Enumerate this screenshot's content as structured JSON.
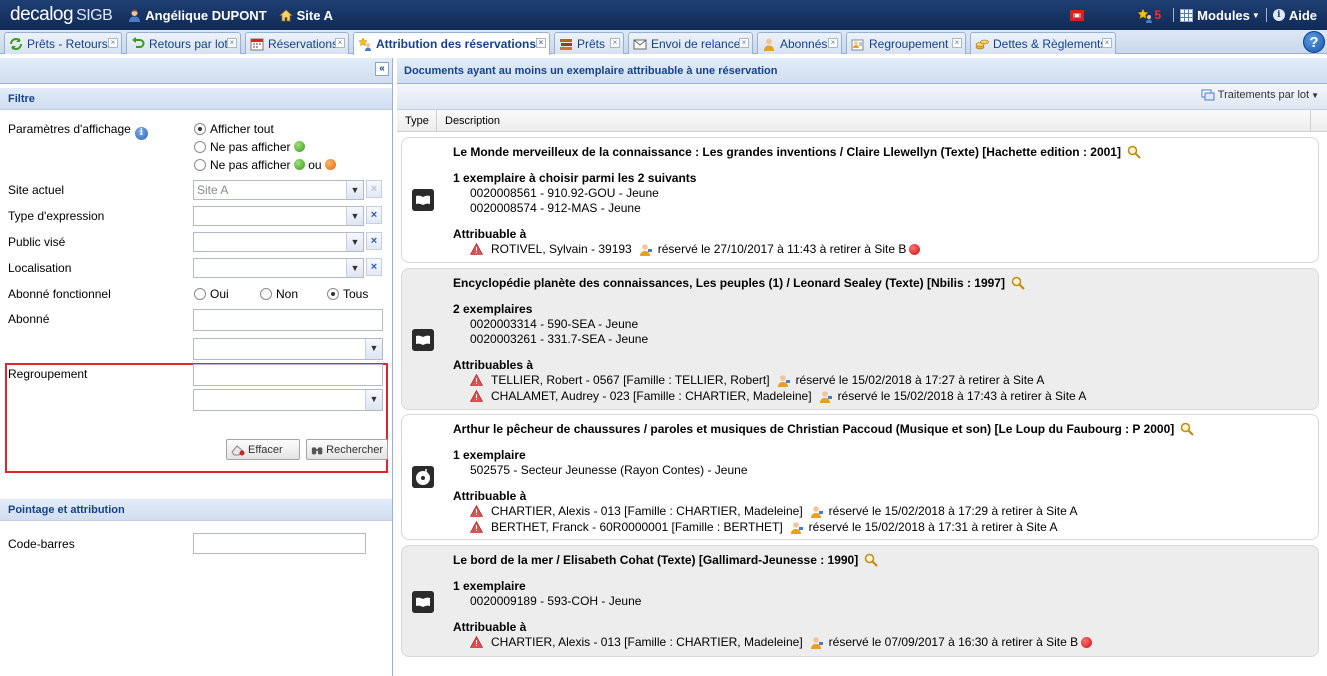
{
  "topbar": {
    "logo": "decalog",
    "logo_suffix": "SIGB",
    "user": "Angélique DUPONT",
    "site": "Site A",
    "star_count": "5",
    "modules": "Modules",
    "help": "Aide",
    "colors": {
      "bar": "#1f3f74",
      "star_count": "#ff3030"
    }
  },
  "tabs": [
    {
      "label": "Prêts - Retours",
      "icon": "loop-icon"
    },
    {
      "label": "Retours par lot",
      "icon": "return-arrow-icon"
    },
    {
      "label": "Réservations",
      "icon": "calendar-icon"
    },
    {
      "label": "Attribution des réservations",
      "icon": "person-star-icon",
      "active": true
    },
    {
      "label": "Prêts",
      "icon": "books-icon"
    },
    {
      "label": "Envoi de relances",
      "icon": "envelope-icon"
    },
    {
      "label": "Abonnés",
      "icon": "person-icon"
    },
    {
      "label": "Regroupement",
      "icon": "group-icon"
    },
    {
      "label": "Dettes & Règlements",
      "icon": "coins-icon"
    }
  ],
  "help_button": "?",
  "filter": {
    "title": "Filtre",
    "display_params_label": "Paramètres d'affichage",
    "display_options": [
      "Afficher tout",
      "Ne pas afficher",
      "Ne pas afficher",
      "ou"
    ],
    "current_site_label": "Site actuel",
    "current_site_value": "Site A",
    "expression_type_label": "Type d'expression",
    "audience_label": "Public visé",
    "location_label": "Localisation",
    "functional_label": "Abonné fonctionnel",
    "functional_options": [
      "Oui",
      "Non",
      "Tous"
    ],
    "subscriber_label": "Abonné",
    "grouping_label": "Regroupement",
    "clear_button": "Effacer",
    "search_button": "Rechercher"
  },
  "pointage": {
    "title": "Pointage et attribution",
    "barcode_label": "Code-barres"
  },
  "results": {
    "title": "Documents ayant au moins un exemplaire attribuable à une réservation",
    "batch_button": "Traitements par lot",
    "col_type": "Type",
    "col_description": "Description",
    "items": [
      {
        "title": "Le Monde merveilleux de la connaissance : Les grandes inventions / Claire Llewellyn (Texte) [Hachette edition : 2001]",
        "type_icon": "book-icon",
        "copies_label": "1 exemplaire à choisir parmi les 2 suivants",
        "copies": [
          "0020008561 - 910.92-GOU - Jeune",
          "0020008574 - 912-MAS - Jeune"
        ],
        "assign_label": "Attribuable à",
        "reservations": [
          {
            "who": "ROTIVEL, Sylvain - 39193",
            "what": "réservé le 27/10/2017 à 11:43 à retirer à Site B",
            "red_dot": true
          }
        ]
      },
      {
        "title": "Encyclopédie planète des connaissances, Les peuples (1) / Leonard Sealey (Texte) [Nbilis : 1997]",
        "type_icon": "book-icon",
        "copies_label": "2 exemplaires",
        "copies": [
          "0020003314 - 590-SEA - Jeune",
          "0020003261 - 331.7-SEA - Jeune"
        ],
        "assign_label": "Attribuables à",
        "reservations": [
          {
            "who": "TELLIER, Robert - 0567 [Famille : TELLIER, Robert]",
            "what": "réservé le 15/02/2018 à 17:27 à retirer à Site A",
            "red_dot": false
          },
          {
            "who": "CHALAMET, Audrey - 023 [Famille : CHARTIER, Madeleine]",
            "what": "réservé le 15/02/2018 à 17:43 à retirer à Site A",
            "red_dot": false
          }
        ]
      },
      {
        "title": "Arthur le pêcheur de chaussures / paroles et musiques de Christian Paccoud (Musique et son) [Le Loup du Faubourg : P 2000]",
        "type_icon": "music-disc-icon",
        "copies_label": "1 exemplaire",
        "copies": [
          "502575 - Secteur Jeunesse (Rayon Contes) - Jeune"
        ],
        "assign_label": "Attribuable à",
        "reservations": [
          {
            "who": "CHARTIER, Alexis - 013 [Famille : CHARTIER, Madeleine]",
            "what": "réservé le 15/02/2018 à 17:29 à retirer à Site A",
            "red_dot": false
          },
          {
            "who": "BERTHET, Franck - 60R0000001 [Famille : BERTHET]",
            "what": "réservé le 15/02/2018 à 17:31 à retirer à Site A",
            "red_dot": false
          }
        ]
      },
      {
        "title": "Le bord de la mer / Elisabeth Cohat (Texte) [Gallimard-Jeunesse : 1990]",
        "type_icon": "book-icon",
        "copies_label": "1 exemplaire",
        "copies": [
          "0020009189 - 593-COH - Jeune"
        ],
        "assign_label": "Attribuable à",
        "reservations": [
          {
            "who": "CHARTIER, Alexis - 013 [Famille : CHARTIER, Madeleine]",
            "what": "réservé le 07/09/2017 à 16:30 à retirer à Site B",
            "red_dot": true
          }
        ]
      }
    ]
  }
}
